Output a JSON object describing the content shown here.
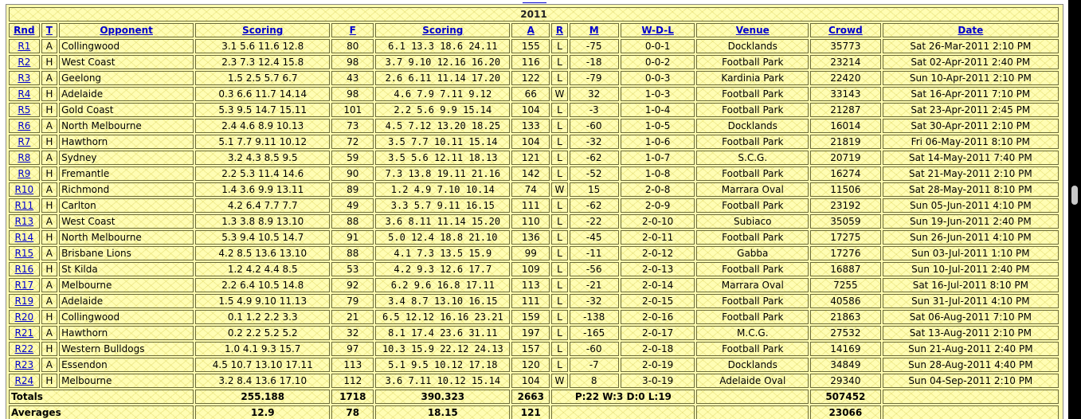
{
  "top_link_text": "",
  "year": "2011",
  "headers": [
    "Rnd",
    "T",
    "Opponent",
    "Scoring",
    "F",
    "Scoring",
    "A",
    "R",
    "M",
    "W-D-L",
    "Venue",
    "Crowd",
    "Date"
  ],
  "rows": [
    {
      "rnd": "R1",
      "t": "A",
      "opp": "Collingwood",
      "score_for": "3.1 5.6 11.6 12.8",
      "f": "80",
      "score_against": "6.1 13.3 18.6 24.11",
      "a": "155",
      "r": "L",
      "m": "-75",
      "wdl": "0-0-1",
      "venue": "Docklands",
      "crowd": "35773",
      "date": "Sat 26-Mar-2011 2:10 PM"
    },
    {
      "rnd": "R2",
      "t": "H",
      "opp": "West Coast",
      "score_for": "2.3 7.3 12.4 15.8",
      "f": "98",
      "score_against": "3.7 9.10 12.16 16.20",
      "a": "116",
      "r": "L",
      "m": "-18",
      "wdl": "0-0-2",
      "venue": "Football Park",
      "crowd": "23214",
      "date": "Sat 02-Apr-2011 2:40 PM"
    },
    {
      "rnd": "R3",
      "t": "A",
      "opp": "Geelong",
      "score_for": "1.5 2.5 5.7 6.7",
      "f": "43",
      "score_against": "2.6 6.11 11.14 17.20",
      "a": "122",
      "r": "L",
      "m": "-79",
      "wdl": "0-0-3",
      "venue": "Kardinia Park",
      "crowd": "22420",
      "date": "Sun 10-Apr-2011 2:10 PM"
    },
    {
      "rnd": "R4",
      "t": "H",
      "opp": "Adelaide",
      "score_for": "0.3 6.6 11.7 14.14",
      "f": "98",
      "score_against": "4.6 7.9 7.11 9.12",
      "a": "66",
      "r": "W",
      "m": "32",
      "wdl": "1-0-3",
      "venue": "Football Park",
      "crowd": "33143",
      "date": "Sat 16-Apr-2011 7:10 PM"
    },
    {
      "rnd": "R5",
      "t": "H",
      "opp": "Gold Coast",
      "score_for": "5.3 9.5 14.7 15.11",
      "f": "101",
      "score_against": "2.2 5.6 9.9 15.14",
      "a": "104",
      "r": "L",
      "m": "-3",
      "wdl": "1-0-4",
      "venue": "Football Park",
      "crowd": "21287",
      "date": "Sat 23-Apr-2011 2:45 PM"
    },
    {
      "rnd": "R6",
      "t": "A",
      "opp": "North Melbourne",
      "score_for": "2.4 4.6 8.9 10.13",
      "f": "73",
      "score_against": "4.5 7.12 13.20 18.25",
      "a": "133",
      "r": "L",
      "m": "-60",
      "wdl": "1-0-5",
      "venue": "Docklands",
      "crowd": "16014",
      "date": "Sat 30-Apr-2011 2:10 PM"
    },
    {
      "rnd": "R7",
      "t": "H",
      "opp": "Hawthorn",
      "score_for": "5.1 7.7 9.11 10.12",
      "f": "72",
      "score_against": "3.5 7.7 10.11 15.14",
      "a": "104",
      "r": "L",
      "m": "-32",
      "wdl": "1-0-6",
      "venue": "Football Park",
      "crowd": "21819",
      "date": "Fri 06-May-2011 8:10 PM"
    },
    {
      "rnd": "R8",
      "t": "A",
      "opp": "Sydney",
      "score_for": "3.2 4.3 8.5 9.5",
      "f": "59",
      "score_against": "3.5 5.6 12.11 18.13",
      "a": "121",
      "r": "L",
      "m": "-62",
      "wdl": "1-0-7",
      "venue": "S.C.G.",
      "crowd": "20719",
      "date": "Sat 14-May-2011 7:40 PM"
    },
    {
      "rnd": "R9",
      "t": "H",
      "opp": "Fremantle",
      "score_for": "2.2 5.3 11.4 14.6",
      "f": "90",
      "score_against": "7.3 13.8 19.11 21.16",
      "a": "142",
      "r": "L",
      "m": "-52",
      "wdl": "1-0-8",
      "venue": "Football Park",
      "crowd": "16274",
      "date": "Sat 21-May-2011 2:10 PM"
    },
    {
      "rnd": "R10",
      "t": "A",
      "opp": "Richmond",
      "score_for": "1.4 3.6 9.9 13.11",
      "f": "89",
      "score_against": "1.2 4.9 7.10 10.14",
      "a": "74",
      "r": "W",
      "m": "15",
      "wdl": "2-0-8",
      "venue": "Marrara Oval",
      "crowd": "11506",
      "date": "Sat 28-May-2011 8:10 PM"
    },
    {
      "rnd": "R11",
      "t": "H",
      "opp": "Carlton",
      "score_for": "4.2 6.4 7.7 7.7",
      "f": "49",
      "score_against": "3.3 5.7 9.11 16.15",
      "a": "111",
      "r": "L",
      "m": "-62",
      "wdl": "2-0-9",
      "venue": "Football Park",
      "crowd": "23192",
      "date": "Sun 05-Jun-2011 4:10 PM"
    },
    {
      "rnd": "R13",
      "t": "A",
      "opp": "West Coast",
      "score_for": "1.3 3.8 8.9 13.10",
      "f": "88",
      "score_against": "3.6 8.11 11.14 15.20",
      "a": "110",
      "r": "L",
      "m": "-22",
      "wdl": "2-0-10",
      "venue": "Subiaco",
      "crowd": "35059",
      "date": "Sun 19-Jun-2011 2:40 PM"
    },
    {
      "rnd": "R14",
      "t": "H",
      "opp": "North Melbourne",
      "score_for": "5.3 9.4 10.5 14.7",
      "f": "91",
      "score_against": "5.0 12.4 18.8 21.10",
      "a": "136",
      "r": "L",
      "m": "-45",
      "wdl": "2-0-11",
      "venue": "Football Park",
      "crowd": "17275",
      "date": "Sun 26-Jun-2011 4:10 PM"
    },
    {
      "rnd": "R15",
      "t": "A",
      "opp": "Brisbane Lions",
      "score_for": "4.2 8.5 13.6 13.10",
      "f": "88",
      "score_against": "4.1 7.3 13.5 15.9",
      "a": "99",
      "r": "L",
      "m": "-11",
      "wdl": "2-0-12",
      "venue": "Gabba",
      "crowd": "17276",
      "date": "Sun 03-Jul-2011 1:10 PM"
    },
    {
      "rnd": "R16",
      "t": "H",
      "opp": "St Kilda",
      "score_for": "1.2 4.2 4.4 8.5",
      "f": "53",
      "score_against": "4.2 9.3 12.6 17.7",
      "a": "109",
      "r": "L",
      "m": "-56",
      "wdl": "2-0-13",
      "venue": "Football Park",
      "crowd": "16887",
      "date": "Sun 10-Jul-2011 2:40 PM"
    },
    {
      "rnd": "R17",
      "t": "A",
      "opp": "Melbourne",
      "score_for": "2.2 6.4 10.5 14.8",
      "f": "92",
      "score_against": "6.2 9.6 16.8 17.11",
      "a": "113",
      "r": "L",
      "m": "-21",
      "wdl": "2-0-14",
      "venue": "Marrara Oval",
      "crowd": "7255",
      "date": "Sat 16-Jul-2011 8:10 PM"
    },
    {
      "rnd": "R19",
      "t": "A",
      "opp": "Adelaide",
      "score_for": "1.5 4.9 9.10 11.13",
      "f": "79",
      "score_against": "3.4 8.7 13.10 16.15",
      "a": "111",
      "r": "L",
      "m": "-32",
      "wdl": "2-0-15",
      "venue": "Football Park",
      "crowd": "40586",
      "date": "Sun 31-Jul-2011 4:10 PM"
    },
    {
      "rnd": "R20",
      "t": "H",
      "opp": "Collingwood",
      "score_for": "0.1 1.2 2.2 3.3",
      "f": "21",
      "score_against": "6.5 12.12 16.16 23.21",
      "a": "159",
      "r": "L",
      "m": "-138",
      "wdl": "2-0-16",
      "venue": "Football Park",
      "crowd": "21863",
      "date": "Sat 06-Aug-2011 7:10 PM"
    },
    {
      "rnd": "R21",
      "t": "A",
      "opp": "Hawthorn",
      "score_for": "0.2 2.2 5.2 5.2",
      "f": "32",
      "score_against": "8.1 17.4 23.6 31.11",
      "a": "197",
      "r": "L",
      "m": "-165",
      "wdl": "2-0-17",
      "venue": "M.C.G.",
      "crowd": "27532",
      "date": "Sat 13-Aug-2011 2:10 PM"
    },
    {
      "rnd": "R22",
      "t": "H",
      "opp": "Western Bulldogs",
      "score_for": "1.0 4.1 9.3 15.7",
      "f": "97",
      "score_against": "10.3 15.9 22.12 24.13",
      "a": "157",
      "r": "L",
      "m": "-60",
      "wdl": "2-0-18",
      "venue": "Football Park",
      "crowd": "14169",
      "date": "Sun 21-Aug-2011 2:40 PM"
    },
    {
      "rnd": "R23",
      "t": "A",
      "opp": "Essendon",
      "score_for": "4.5 10.7 13.10 17.11",
      "f": "113",
      "score_against": "5.1 9.5 10.12 17.18",
      "a": "120",
      "r": "L",
      "m": "-7",
      "wdl": "2-0-19",
      "venue": "Docklands",
      "crowd": "34849",
      "date": "Sun 28-Aug-2011 4:40 PM"
    },
    {
      "rnd": "R24",
      "t": "H",
      "opp": "Melbourne",
      "score_for": "3.2 8.4 13.6 17.10",
      "f": "112",
      "score_against": "3.6 7.11 10.12 15.14",
      "a": "104",
      "r": "W",
      "m": "8",
      "wdl": "3-0-19",
      "venue": "Adelaide Oval",
      "crowd": "29340",
      "date": "Sun 04-Sep-2011 2:10 PM"
    }
  ],
  "totals": {
    "label": "Totals",
    "score_for": "255.188",
    "f": "1718",
    "score_against": "390.323",
    "a": "2663",
    "record": "P:22 W:3 D:0 L:19",
    "crowd": "507452"
  },
  "averages": {
    "label": "Averages",
    "score_for": "12.9",
    "f": "78",
    "score_against": "18.15",
    "a": "121",
    "crowd": "23066"
  }
}
